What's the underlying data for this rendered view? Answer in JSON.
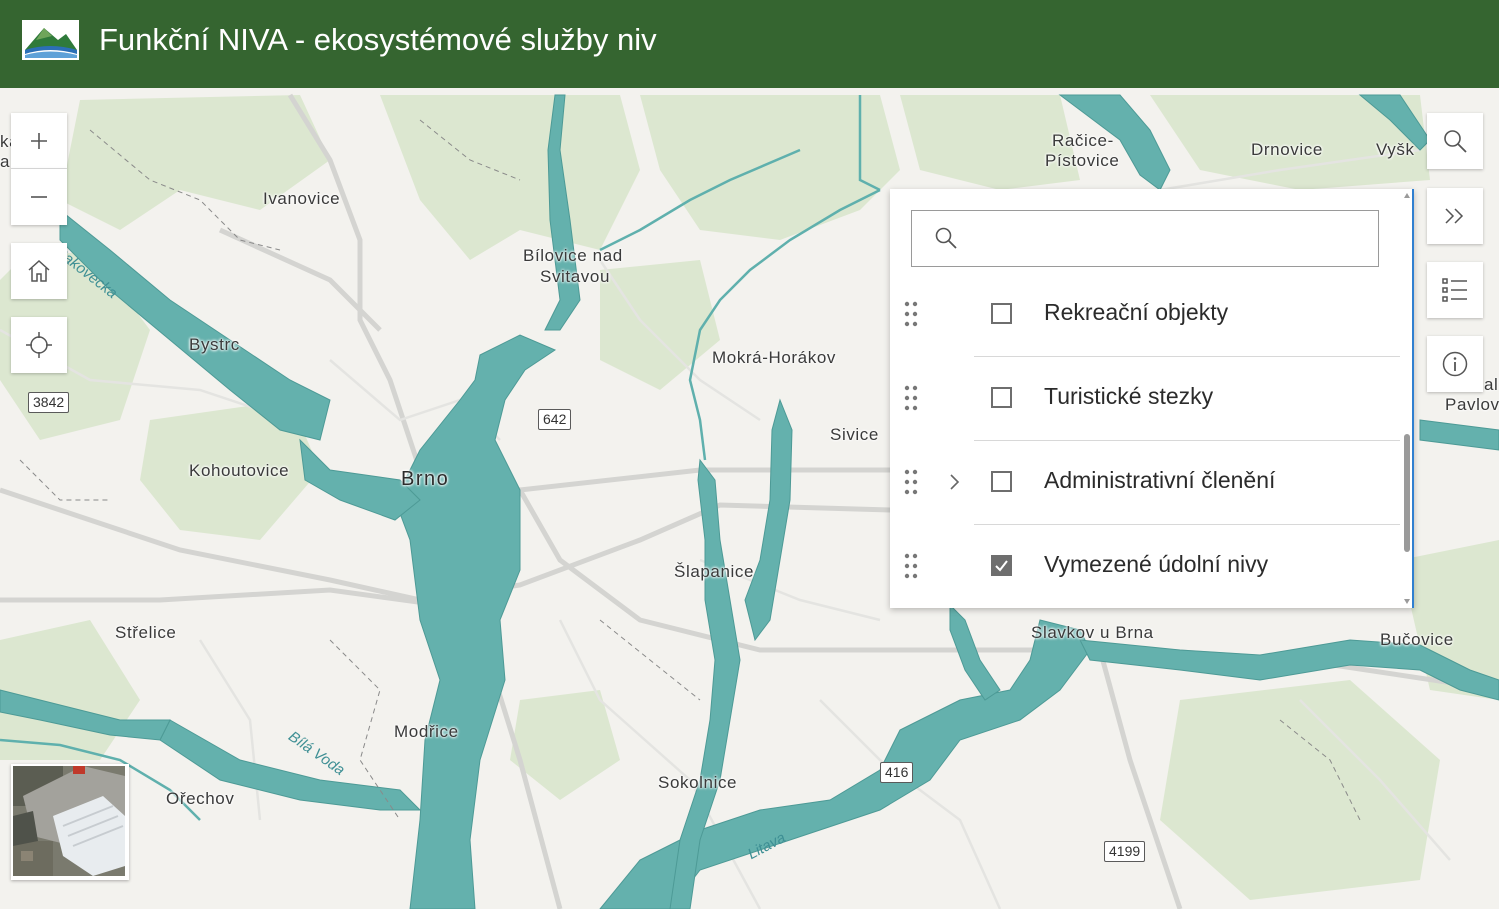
{
  "header": {
    "title": "Funkční NIVA - ekosystémové služby niv",
    "logo_icon": "mountain-river-logo-icon",
    "background_color": "#356530"
  },
  "map_controls": {
    "zoom_in_icon": "plus-icon",
    "zoom_out_icon": "minus-icon",
    "home_icon": "home-icon",
    "locate_icon": "crosshair-locate-icon",
    "basemap_toggle_icon": "satellite-basemap-thumbnail"
  },
  "right_toolbar": {
    "search_icon": "search-icon",
    "collapse_icon": "double-chevron-right-icon",
    "layer_list_icon": "layer-list-icon",
    "info_icon": "info-icon"
  },
  "layer_list": {
    "search_placeholder": "",
    "search_icon": "search-icon",
    "layers": [
      {
        "label": "Rekreační objekty",
        "checked": false,
        "expandable": false
      },
      {
        "label": "Turistické stezky",
        "checked": false,
        "expandable": false
      },
      {
        "label": "Administrativní členění",
        "checked": false,
        "expandable": true
      },
      {
        "label": "Vymezené údolní nivy",
        "checked": true,
        "expandable": false
      }
    ]
  },
  "map_labels": {
    "places": [
      "Ivanovice",
      "Bílovice nad",
      "Svitavou",
      "Račice-",
      "Pístovice",
      "Drnovice",
      "Vyšk",
      "Bystrc",
      "Mokrá-Horákov",
      "Sivice",
      "Kohoutovice",
      "Brno",
      "Šlapanice",
      "Střelice",
      "Slavkov u Brna",
      "Bučovice",
      "Modřice",
      "Sokolnice",
      "Ořechov",
      "Pavlov",
      "ka",
      "a",
      "al"
    ],
    "rivers": [
      "Rakovecka",
      "Bílá Voda",
      "Litava"
    ],
    "road_shields": [
      "3842",
      "642",
      "416",
      "4199"
    ]
  },
  "colors": {
    "floodplain": "#64b1ad",
    "land": "#f3f2ee",
    "forest": "#dce7d0",
    "road": "#d9d9d6",
    "panel_frame": "#2f7fd0"
  }
}
